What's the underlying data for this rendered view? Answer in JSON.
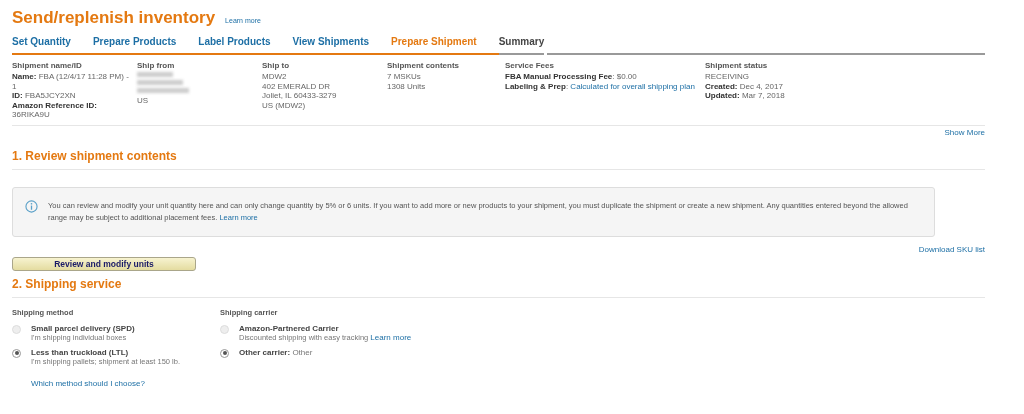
{
  "header": {
    "title": "Send/replenish inventory",
    "learn_more": "Learn more"
  },
  "steps": [
    {
      "label": "Set Quantity",
      "selected": false
    },
    {
      "label": "Prepare Products",
      "selected": false
    },
    {
      "label": "Label Products",
      "selected": false
    },
    {
      "label": "View Shipments",
      "selected": false
    },
    {
      "label": "Prepare Shipment",
      "selected": true
    },
    {
      "label": "Summary",
      "selected": false
    }
  ],
  "summary": [
    {
      "heading": "Shipment name/ID",
      "lines": [
        {
          "label": "Name:",
          "text": "FBA (12/4/17 11:28 PM) - 1"
        },
        {
          "label": "ID:",
          "text": "FBA5JCY2XN"
        },
        {
          "label": "Amazon Reference ID:"
        },
        {
          "text": "36RIKA9U"
        }
      ]
    },
    {
      "heading": "Ship from",
      "redacted": true,
      "lines": [
        {
          "text": "US"
        }
      ]
    },
    {
      "heading": "Ship to",
      "lines": [
        {
          "text": "MDW2"
        },
        {
          "text": "402 EMERALD DR"
        },
        {
          "text": "Joliet, IL 60433-3279"
        },
        {
          "text": "US (MDW2)"
        }
      ]
    },
    {
      "heading": "Shipment contents",
      "lines": [
        {
          "text": "7 MSKUs"
        },
        {
          "text": "1308 Units"
        }
      ]
    },
    {
      "heading": "Service Fees",
      "lines": [
        {
          "label": "FBA Manual Processing Fee",
          "text": ": $0.00"
        },
        {
          "label": "Labeling & Prep",
          "text": ": ",
          "link": "Calculated for overall shipping plan"
        }
      ]
    },
    {
      "heading": "Shipment status",
      "lines": [
        {
          "text": "RECEIVING"
        },
        {
          "label": "Created:",
          "text": "Dec 4, 2017"
        },
        {
          "label": "Updated:",
          "text": "Mar 7, 2018"
        }
      ]
    }
  ],
  "show_more": "Show More",
  "review": {
    "title": "1. Review shipment contents",
    "notice": "You can review and modify your unit quantity here and can only change quantity by 5% or 6 units. If you want to add more or new products to your shipment, you must duplicate the shipment or create a new shipment. Any quantities entered beyond the allowed range may be subject to additional placement fees.",
    "notice_link": "Learn more",
    "button": "Review and modify units",
    "download": "Download SKU list"
  },
  "shipping": {
    "title": "2. Shipping service",
    "method": {
      "heading": "Shipping method",
      "options": [
        {
          "label": "Small parcel delivery (SPD)",
          "description": "I'm shipping individual boxes",
          "selected": false
        },
        {
          "label": "Less than truckload (LTL)",
          "description": "I'm shipping pallets; shipment at least 150 lb.",
          "selected": true
        }
      ],
      "help": "Which method should I choose?"
    },
    "carrier": {
      "heading": "Shipping carrier",
      "options": [
        {
          "label": "Amazon-Partnered Carrier",
          "description": "Discounted shipping with easy tracking",
          "link": "Learn more",
          "selected": false
        },
        {
          "label": "Other carrier:",
          "value": "Other",
          "selected": true
        }
      ]
    }
  }
}
